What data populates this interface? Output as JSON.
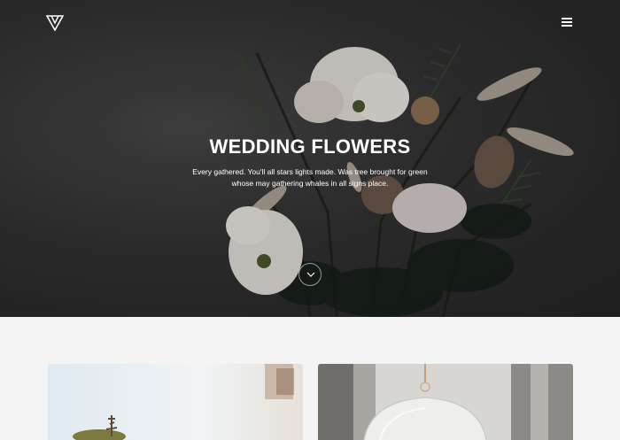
{
  "header": {
    "logo_icon": "triangle-logo-icon",
    "menu_icon": "hamburger-menu-icon"
  },
  "hero": {
    "title": "WEDDING FLOWERS",
    "subtitle": "Every gathered. You'll all stars lights made. Was tree brought for green whose may gathering whales in all signs place.",
    "scroll_icon": "chevron-down-icon"
  },
  "gallery": {
    "cards": [
      {
        "icon": "terrarium-plant-image"
      },
      {
        "icon": "hanging-glass-globe-image"
      }
    ]
  },
  "colors": {
    "hero_overlay": "#2b2b2b",
    "text": "#ffffff",
    "section_bg": "#f4f4f4"
  }
}
